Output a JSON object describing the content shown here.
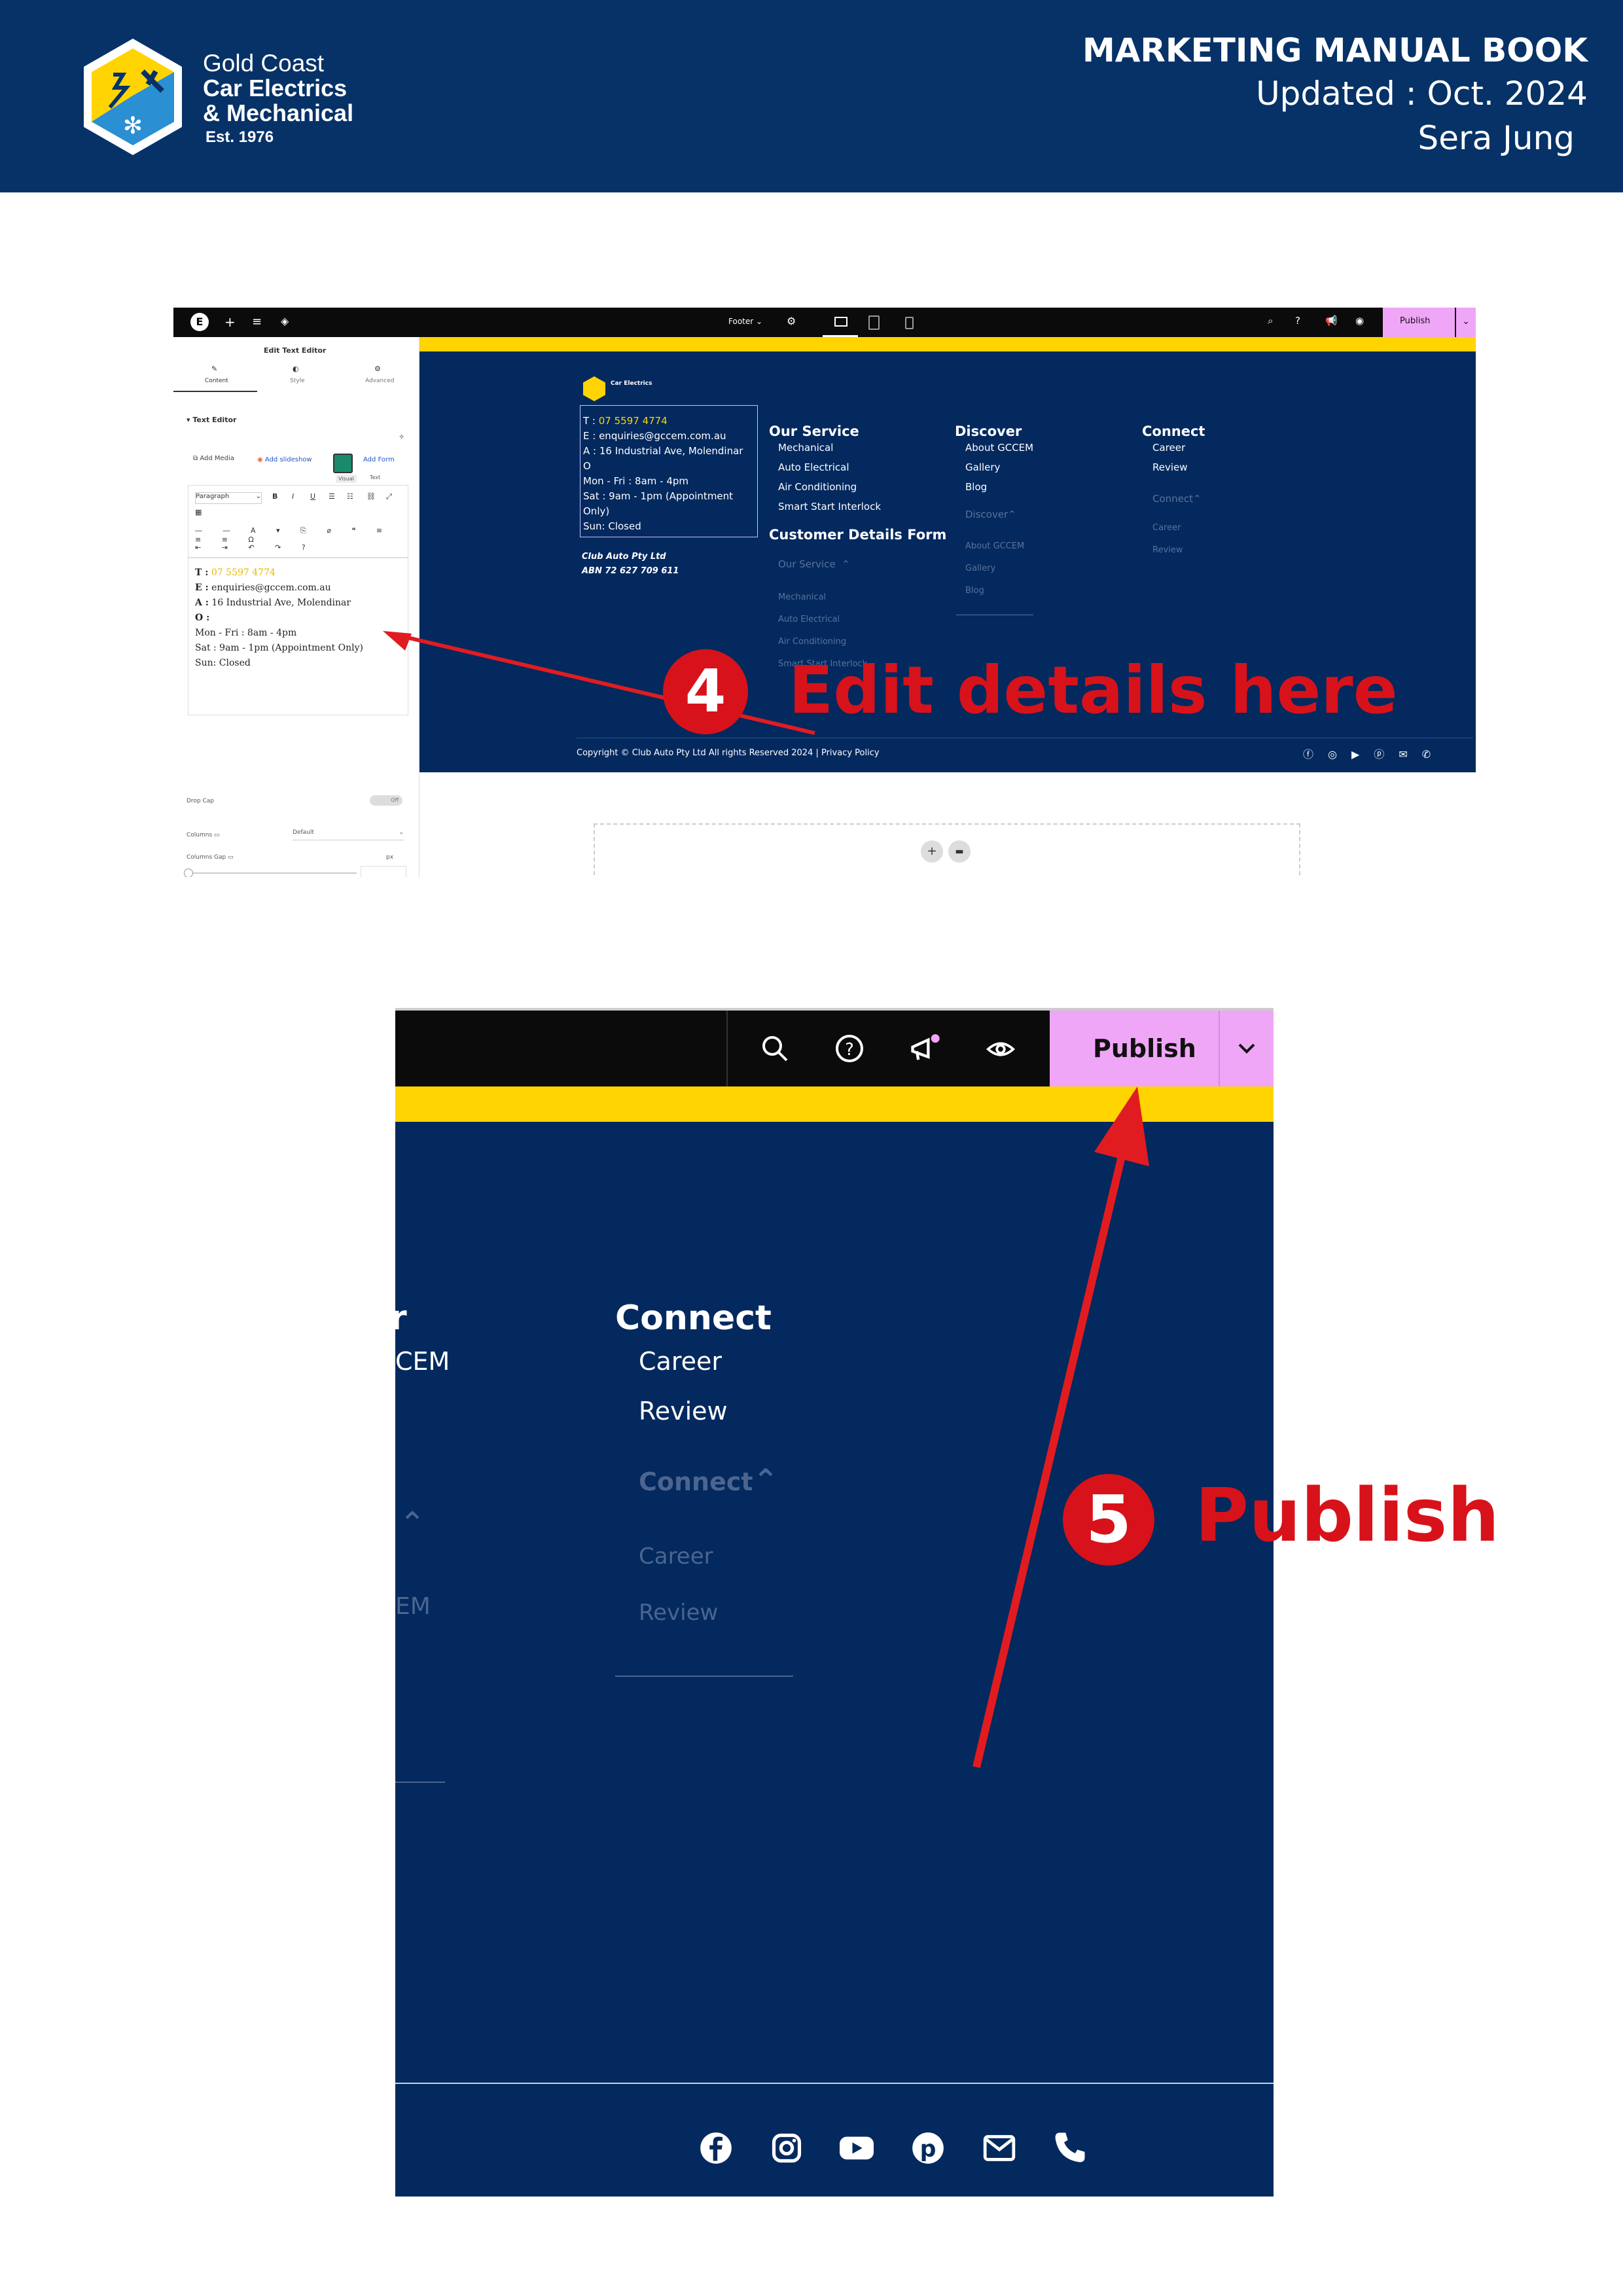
{
  "header": {
    "logo_line1": "Gold Coast",
    "logo_line2": "Car Electrics",
    "logo_line3": "& Mechanical",
    "logo_est": "Est. 1976",
    "title": "MARKETING MANUAL BOOK",
    "updated": "Updated : Oct. 2024",
    "author": "Sera Jung"
  },
  "shot1": {
    "topbar": {
      "footer_label": "Footer",
      "publish_label": "Publish"
    },
    "panel": {
      "title": "Edit Text Editor",
      "tabs": [
        "Content",
        "Style",
        "Advanced"
      ],
      "section": "Text Editor",
      "add_media": "Add Media",
      "add_slideshow": "Add slideshow",
      "add_form": "Add Form",
      "visual_tab": "Visual",
      "text_tab": "Text",
      "format_select": "Paragraph",
      "drop_cap": "Drop Cap",
      "drop_cap_toggle": "Off",
      "columns": "Columns",
      "columns_value": "Default",
      "columns_gap": "Columns Gap",
      "columns_gap_unit": "px",
      "editor_lines": [
        {
          "label": "T :",
          "value": "07 5597 4774"
        },
        {
          "label": "E :",
          "value": "enquiries@gccem.com.au"
        },
        {
          "label": "A :",
          "value": "16 Industrial Ave, Molendinar"
        },
        {
          "label": "O :",
          "value": ""
        },
        {
          "label": "",
          "value": "Mon - Fri : 8am - 4pm"
        },
        {
          "label": "",
          "value": "Sat : 9am - 1pm (Appointment Only)"
        },
        {
          "label": "",
          "value": "Sun: Closed"
        }
      ]
    },
    "footer": {
      "contact_lines": [
        {
          "label": "T : ",
          "value": "07 5597 4774"
        },
        {
          "label": "E : ",
          "value": "enquiries@gccem.com.au"
        },
        {
          "label": "A : ",
          "value": "16 Industrial Ave, Molendinar"
        },
        {
          "label": "O",
          "value": ""
        },
        {
          "label": "",
          "value": "Mon - Fri : 8am - 4pm"
        },
        {
          "label": "",
          "value": "Sat : 9am - 1pm (Appointment Only)"
        },
        {
          "label": "",
          "value": "Sun: Closed"
        }
      ],
      "company": "Club Auto Pty Ltd",
      "abn": "ABN 72 627 709 611",
      "our_service": {
        "heading": "Our Service",
        "links": [
          "Mechanical",
          "Auto Electrical",
          "Air Conditioning",
          "Smart Start Interlock"
        ],
        "form_heading": "Customer Details Form",
        "collapsed": "Our Service",
        "collapsed_links": [
          "Mechanical",
          "Auto Electrical",
          "Air Conditioning",
          "Smart Start Interlock"
        ]
      },
      "discover": {
        "heading": "Discover",
        "links": [
          "About GCCEM",
          "Gallery",
          "Blog"
        ],
        "collapsed": "Discover",
        "collapsed_links": [
          "About GCCEM",
          "Gallery",
          "Blog"
        ]
      },
      "connect": {
        "heading": "Connect",
        "links": [
          "Career",
          "Review"
        ],
        "collapsed": "Connect",
        "collapsed_links": [
          "Career",
          "Review"
        ]
      },
      "copyright": "Copyright © Club Auto Pty Ltd All rights Reserved 2024 | Privacy Policy"
    },
    "annotation_number": "4",
    "annotation_text": "Edit details here"
  },
  "shot2": {
    "publish_label": "Publish",
    "partial_heading": "r",
    "partial_link": "CEM",
    "partial_dim": "EM",
    "connect_heading": "Connect",
    "connect_links": [
      "Career",
      "Review"
    ],
    "connect_collapsed": "Connect",
    "connect_collapsed_links": [
      "Career",
      "Review"
    ],
    "annotation_number": "5",
    "annotation_text": "Publish"
  },
  "colors": {
    "navy": "#063268",
    "footer_navy": "#03295e",
    "yellow_bar": "#ffd400",
    "publish_pink": "#f0a6f7",
    "annotation_red": "#d8121a",
    "phone_yellow": "#ffd400"
  },
  "icons": [
    "wrench-icon",
    "snowflake-icon",
    "search-icon",
    "help-icon",
    "megaphone-icon",
    "eye-icon",
    "chevron-down-icon",
    "facebook-icon",
    "instagram-icon",
    "youtube-icon",
    "pinterest-icon",
    "mail-icon",
    "phone-icon"
  ]
}
